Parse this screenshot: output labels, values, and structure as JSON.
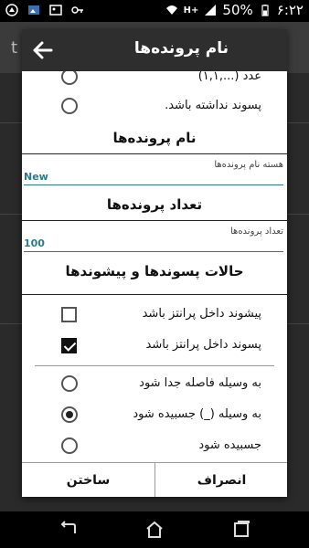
{
  "status_bar": {
    "time": "۶:۲۲",
    "battery": "50%",
    "network": "H+"
  },
  "background_app": {
    "title_fragment": "t"
  },
  "dialog": {
    "title": "نام پرونده‌ها",
    "cut_option_label": "عدد (...,۱,۱)",
    "no_suffix_label": "پسوند نداشته باشد.",
    "filename_section": {
      "title": "نام پرونده‌ها",
      "field_label": "هسته نام پرونده‌ها",
      "field_value": "New"
    },
    "count_section": {
      "title": "تعداد پرونده‌ها",
      "field_label": "تعداد پرونده‌ها",
      "field_value": "100"
    },
    "modes_section": {
      "title": "حالات پسوندها و پیشوندها"
    },
    "checkboxes": [
      {
        "label": "پیشوند داخل پرانتز باشد",
        "checked": false
      },
      {
        "label": "پسوند داخل پرانتز باشد",
        "checked": true
      }
    ],
    "separator_options": [
      {
        "label": "به وسیله فاصله جدا شود",
        "selected": false
      },
      {
        "label": "به وسیله (_) جسبیده شود",
        "selected": true
      },
      {
        "label": "جسبیده شود",
        "selected": false
      }
    ],
    "buttons": {
      "build": "ساختن",
      "cancel": "انصراف"
    }
  },
  "colors": {
    "accent": "#2a7a8c",
    "header": "#2e2e2e",
    "background_dim": "#2a2a2a"
  }
}
